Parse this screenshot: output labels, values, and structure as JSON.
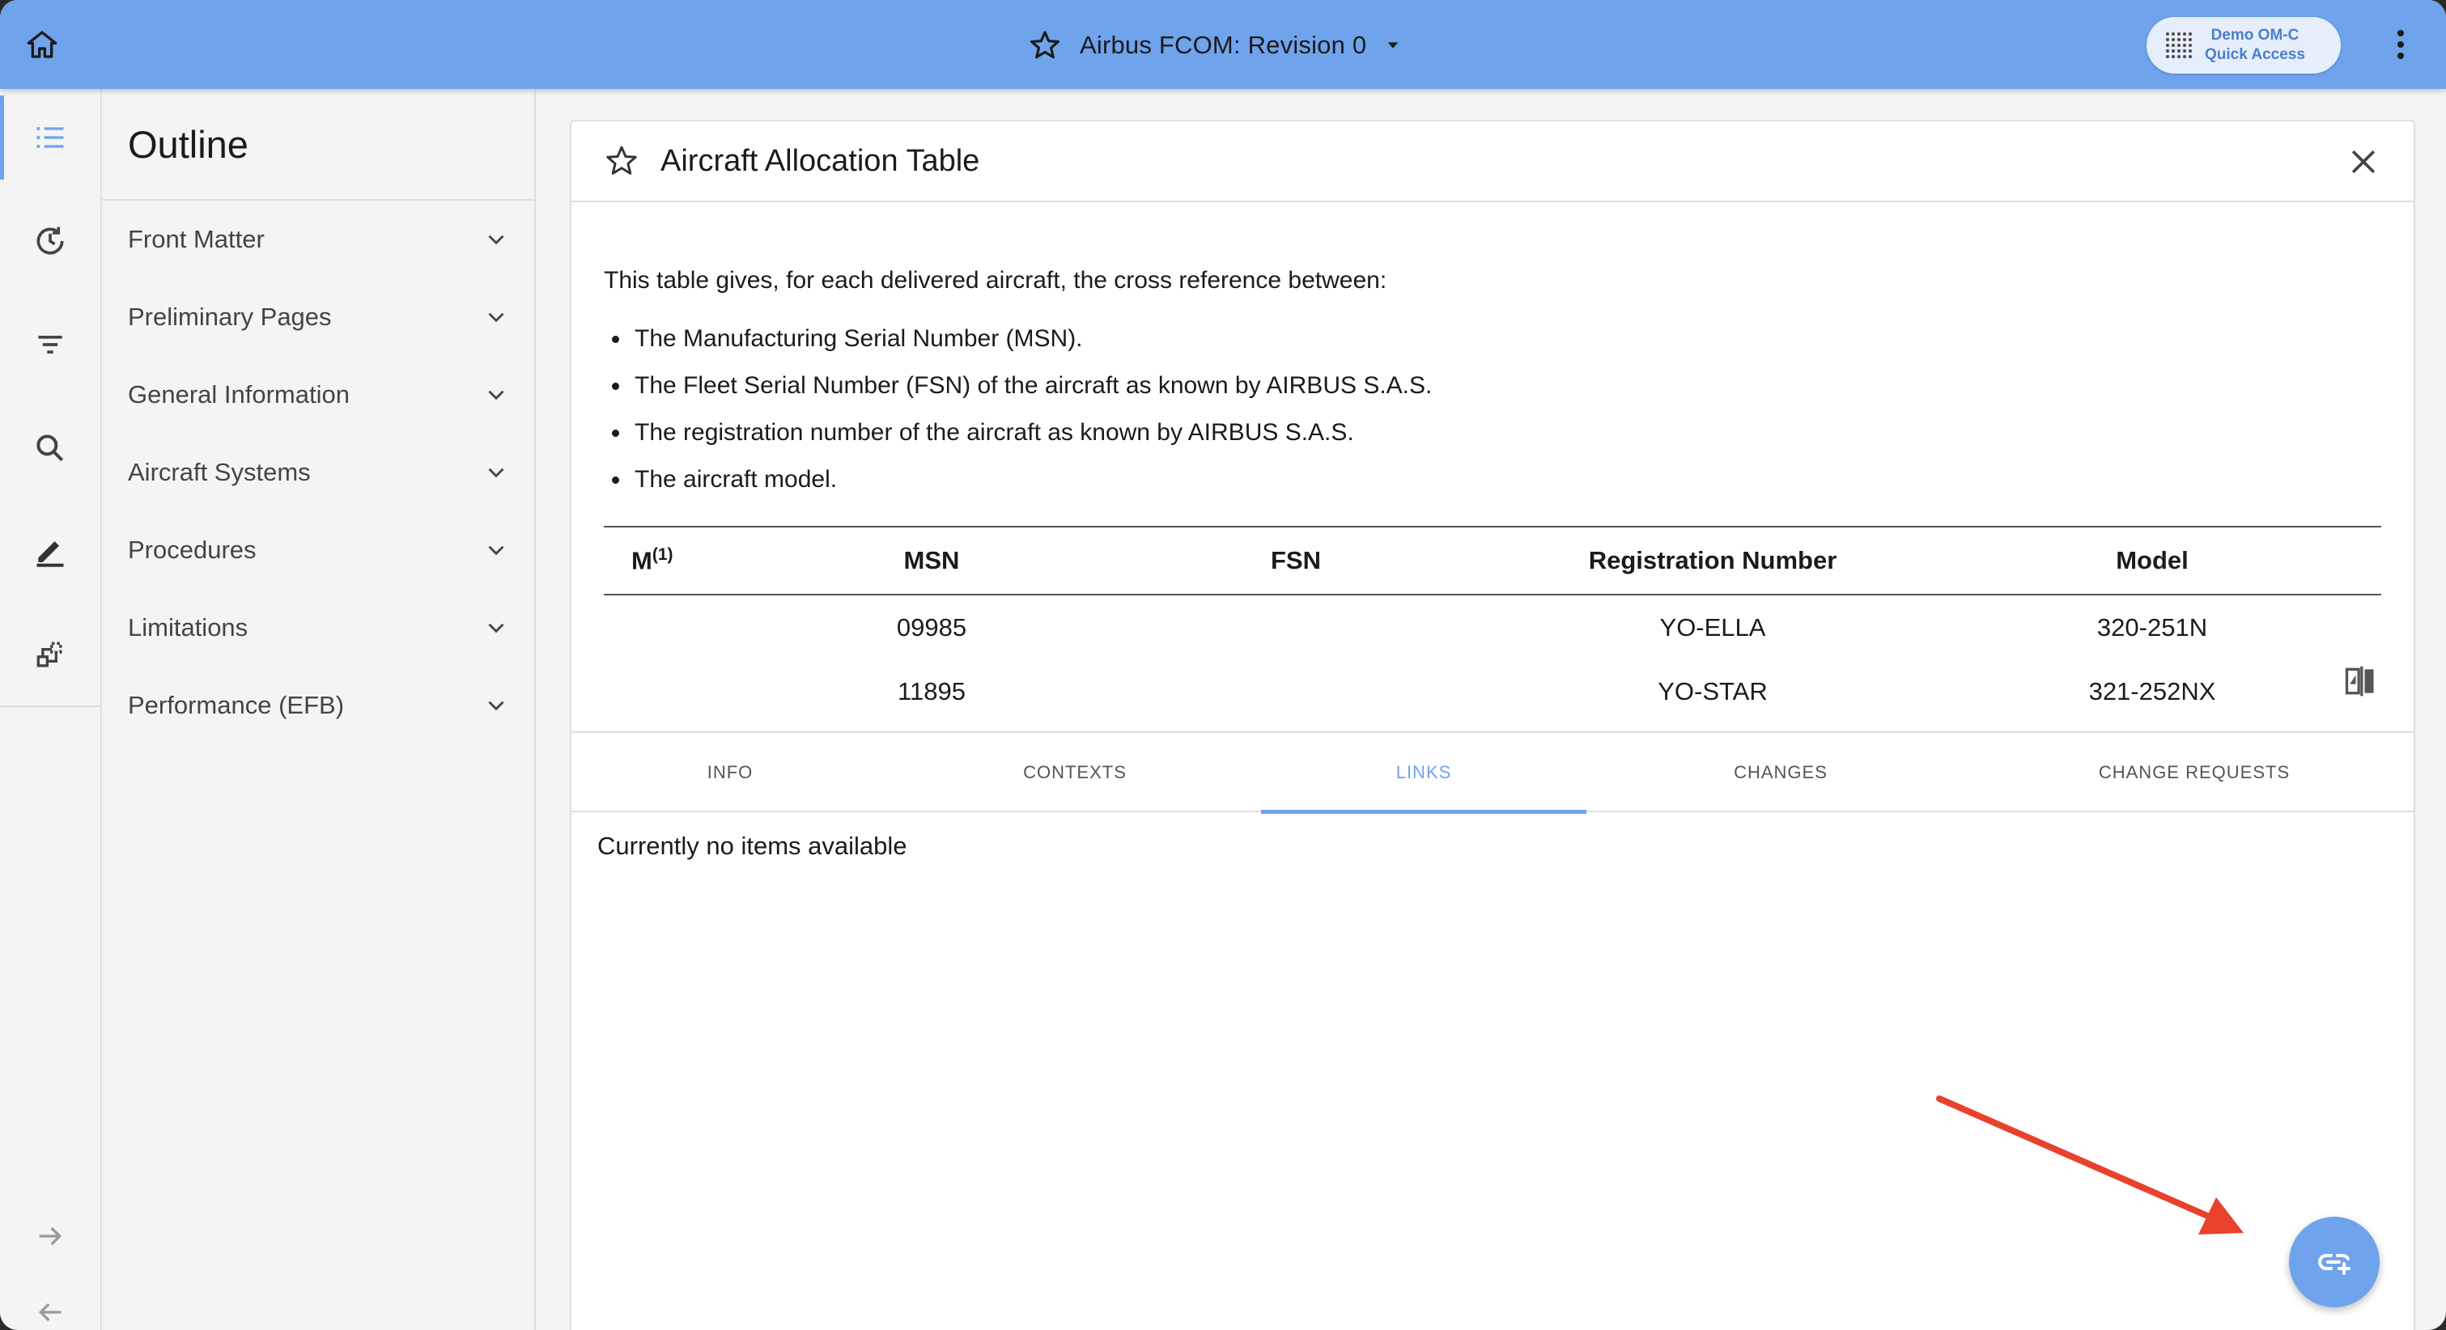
{
  "header": {
    "title": "Airbus FCOM: Revision 0",
    "quick_access_line1": "Demo OM-C",
    "quick_access_line2": "Quick Access",
    "accent_color": "#6fa3ec"
  },
  "rail": {
    "items": [
      "outline-icon",
      "history-icon",
      "filter-icon",
      "search-icon",
      "edit-icon",
      "compare-structure-icon"
    ],
    "bottom_items": [
      "arrow-right-icon",
      "arrow-left-icon"
    ]
  },
  "outline": {
    "title": "Outline",
    "items": [
      {
        "label": "Front Matter"
      },
      {
        "label": "Preliminary Pages"
      },
      {
        "label": "General Information"
      },
      {
        "label": "Aircraft Systems"
      },
      {
        "label": "Procedures"
      },
      {
        "label": "Limitations"
      },
      {
        "label": "Performance (EFB)"
      }
    ]
  },
  "document": {
    "title": "Aircraft Allocation Table",
    "intro": "This table gives, for each delivered aircraft, the cross reference between:",
    "bullets": [
      "The Manufacturing Serial Number (MSN).",
      "The Fleet Serial Number (FSN) of the aircraft as known by AIRBUS S.A.S.",
      "The registration number of the aircraft as known by AIRBUS S.A.S.",
      "The aircraft model."
    ],
    "table": {
      "headers": {
        "m": "M",
        "m_sup": "(1)",
        "msn": "MSN",
        "fsn": "FSN",
        "reg": "Registration Number",
        "model": "Model"
      },
      "rows": [
        {
          "m": "",
          "msn": "09985",
          "fsn": "",
          "reg": "YO-ELLA",
          "model": "320-251N"
        },
        {
          "m": "",
          "msn": "11895",
          "fsn": "",
          "reg": "YO-STAR",
          "model": "321-252NX"
        }
      ]
    }
  },
  "tabs": {
    "items": [
      {
        "label": "INFO"
      },
      {
        "label": "CONTEXTS"
      },
      {
        "label": "LINKS"
      },
      {
        "label": "CHANGES"
      },
      {
        "label": "CHANGE REQUESTS"
      }
    ],
    "active": "LINKS",
    "empty_message": "Currently no items available"
  },
  "fab": {
    "icon": "add-link-icon"
  },
  "annotation": {
    "color": "#e8412c"
  }
}
